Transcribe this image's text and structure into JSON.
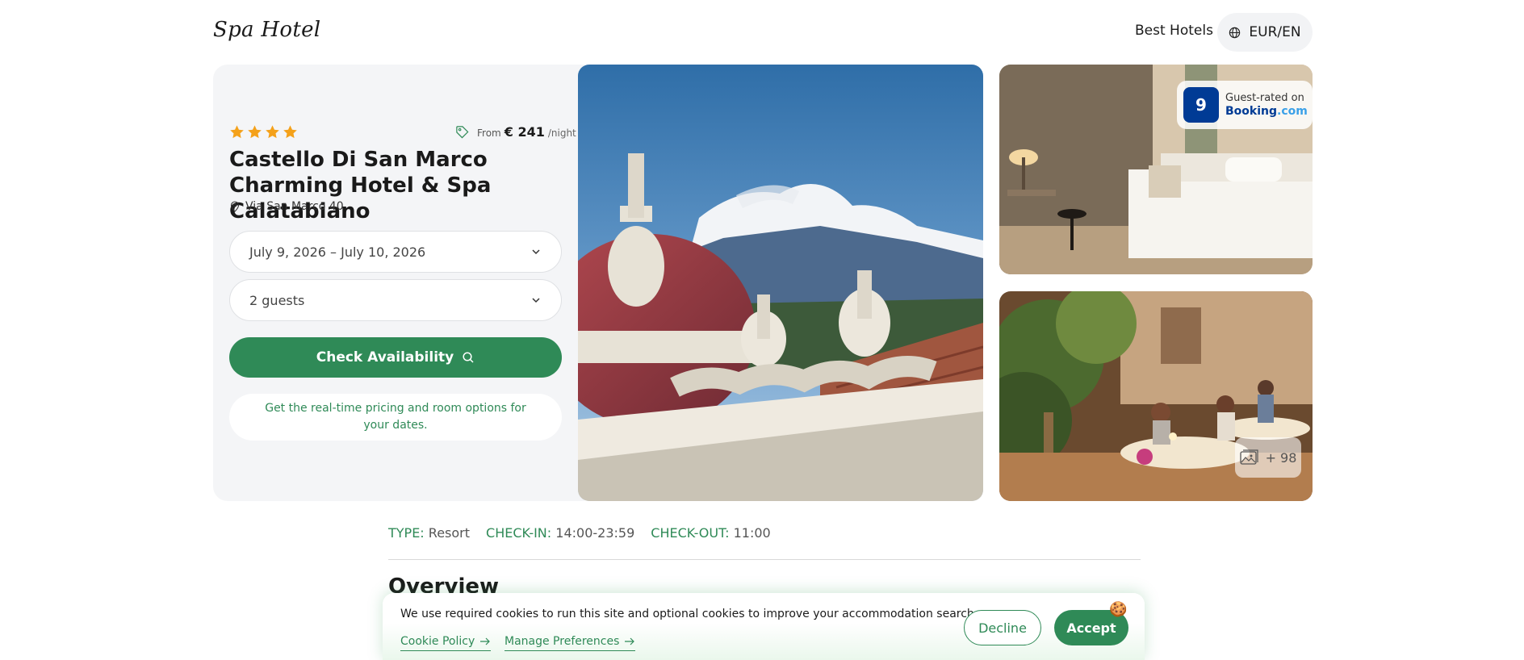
{
  "header": {
    "logo": "Spa Hotel",
    "nav_best_hotels": "Best Hotels",
    "currency_lang": "EUR/EN"
  },
  "hotel": {
    "stars": 4,
    "price_from": "From",
    "price_amount": "€ 241",
    "price_per": "/night",
    "name": "Castello Di San Marco Charming Hotel & Spa Calatabiano",
    "address": "Via San Marco 40",
    "dates_value": "July 9, 2026 – July 10, 2026",
    "guests_value": "2 guests",
    "check_button": "Check Availability",
    "hint": "Get the real-time pricing and room options for your dates."
  },
  "rating": {
    "score": "9",
    "label": "Guest-rated on",
    "brand_main": "Booking",
    "brand_suffix": ".com"
  },
  "gallery": {
    "more_count": "+ 98"
  },
  "details": {
    "type_label": "TYPE:",
    "type_value": "Resort",
    "checkin_label": "CHECK-IN:",
    "checkin_value": "14:00-23:59",
    "checkout_label": "CHECK-OUT:",
    "checkout_value": "11:00",
    "overview_heading": "Overview"
  },
  "cookie": {
    "message": "We use required cookies to run this site and optional cookies to improve your accommodation search.",
    "policy_link": "Cookie Policy",
    "prefs_link": "Manage Preferences",
    "decline": "Decline",
    "accept": "Accept"
  },
  "colors": {
    "accent_green": "#2f8a57",
    "booking_blue": "#003b95",
    "star_orange": "#f4a11a"
  }
}
